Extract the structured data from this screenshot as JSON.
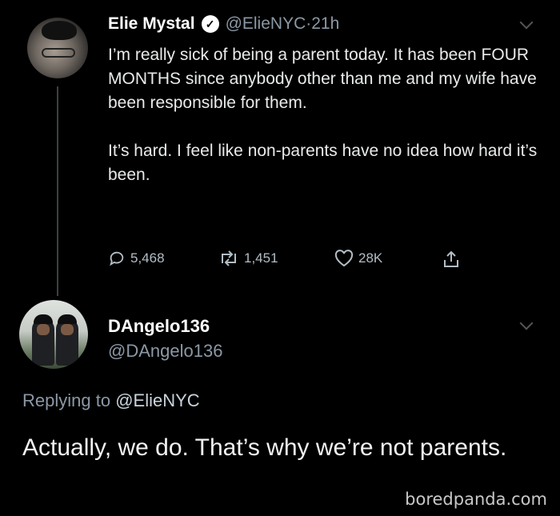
{
  "tweet1": {
    "name": "Elie Mystal",
    "handle": "@ElieNYC",
    "separator": " · ",
    "time": "21h",
    "paragraphs": [
      "I’m really sick of being a parent today. It has been FOUR MONTHS since anybody other than me and my wife have been responsible for them.",
      "It’s hard. I feel like non-parents have no idea how hard it’s been."
    ],
    "replies": "5,468",
    "retweets": "1,451",
    "likes": "28K"
  },
  "tweet2": {
    "name": "DAngelo136",
    "handle": "@DAngelo136",
    "replying_prefix": "Replying to ",
    "replying_to": "@ElieNYC",
    "body": "Actually, we do. That’s why we’re not parents."
  },
  "watermark": "boredpanda.com",
  "colors": {
    "background": "#000000",
    "text": "#ffffff",
    "muted": "#8b98a5"
  }
}
